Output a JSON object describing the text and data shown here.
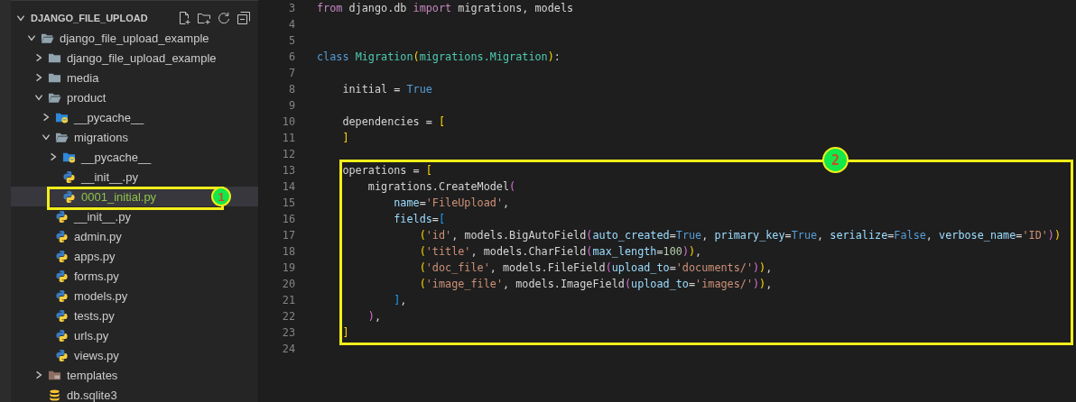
{
  "explorer": {
    "title": "DJANGO_FILE_UPLOAD",
    "expanded": true,
    "tree": [
      {
        "label": "django_file_upload_example",
        "kind": "folder",
        "expanded": true,
        "selected": false,
        "untracked": false,
        "children": [
          {
            "label": "django_file_upload_example",
            "kind": "folder",
            "expanded": false,
            "selected": false,
            "untracked": false
          },
          {
            "label": "media",
            "kind": "folder",
            "expanded": false,
            "selected": false,
            "untracked": false
          },
          {
            "label": "product",
            "kind": "folder",
            "expanded": true,
            "selected": false,
            "untracked": false,
            "children": [
              {
                "label": "__pycache__",
                "kind": "pyfolder",
                "expanded": false,
                "selected": false,
                "untracked": false
              },
              {
                "label": "migrations",
                "kind": "folder",
                "expanded": true,
                "selected": false,
                "untracked": false,
                "children": [
                  {
                    "label": "__pycache__",
                    "kind": "pyfolder",
                    "expanded": false,
                    "selected": false,
                    "untracked": false
                  },
                  {
                    "label": "__init__.py",
                    "kind": "python",
                    "selected": false,
                    "untracked": false
                  },
                  {
                    "label": "0001_initial.py",
                    "kind": "python",
                    "selected": true,
                    "untracked": true,
                    "callout": "1"
                  }
                ]
              },
              {
                "label": "__init__.py",
                "kind": "python",
                "selected": false,
                "untracked": false
              },
              {
                "label": "admin.py",
                "kind": "python",
                "selected": false,
                "untracked": false
              },
              {
                "label": "apps.py",
                "kind": "python",
                "selected": false,
                "untracked": false
              },
              {
                "label": "forms.py",
                "kind": "python",
                "selected": false,
                "untracked": false
              },
              {
                "label": "models.py",
                "kind": "python",
                "selected": false,
                "untracked": false
              },
              {
                "label": "tests.py",
                "kind": "python",
                "selected": false,
                "untracked": false
              },
              {
                "label": "urls.py",
                "kind": "python",
                "selected": false,
                "untracked": false
              },
              {
                "label": "views.py",
                "kind": "python",
                "selected": false,
                "untracked": false
              }
            ]
          },
          {
            "label": "templates",
            "kind": "templates",
            "expanded": false,
            "selected": false,
            "untracked": false
          },
          {
            "label": "db.sqlite3",
            "kind": "database",
            "selected": false,
            "untracked": false
          }
        ]
      }
    ]
  },
  "editor": {
    "lines_before": [
      {
        "number": "3",
        "tokens": [
          {
            "kind": "import",
            "text": "from"
          },
          {
            "kind": "plain",
            "text": " django.db "
          },
          {
            "kind": "import",
            "text": "import"
          },
          {
            "kind": "plain",
            "text": " migrations, models"
          }
        ]
      },
      {
        "number": "4"
      },
      {
        "number": "5"
      },
      {
        "number": "6",
        "tokens": [
          {
            "kind": "keyword",
            "text": "class "
          },
          {
            "kind": "class",
            "text": "Migration"
          },
          {
            "kind": "bracket1",
            "text": "("
          },
          {
            "kind": "class",
            "text": "migrations.Migration"
          },
          {
            "kind": "bracket1",
            "text": ")"
          },
          {
            "kind": "plain",
            "text": ":"
          }
        ]
      },
      {
        "number": "7"
      },
      {
        "number": "8",
        "tokens": [
          {
            "kind": "plain",
            "text": "    initial = "
          },
          {
            "kind": "keyword",
            "text": "True"
          }
        ]
      },
      {
        "number": "9"
      },
      {
        "number": "10",
        "tokens": [
          {
            "kind": "plain",
            "text": "    dependencies = "
          },
          {
            "kind": "bracket1",
            "text": "["
          }
        ]
      },
      {
        "number": "11",
        "tokens": [
          {
            "kind": "bracket1",
            "text": "    ]"
          }
        ]
      },
      {
        "number": "12"
      }
    ],
    "callout": {
      "label": "2",
      "lines": [
        {
          "number": "13",
          "tokens": [
            {
              "kind": "plain",
              "text": "    operations = "
            },
            {
              "kind": "bracket1",
              "text": "["
            }
          ]
        },
        {
          "number": "14",
          "tokens": [
            {
              "kind": "plain",
              "text": "        migrations.CreateModel"
            },
            {
              "kind": "bracket2",
              "text": "("
            }
          ]
        },
        {
          "number": "15",
          "tokens": [
            {
              "kind": "param",
              "text": "            name"
            },
            {
              "kind": "plain",
              "text": "="
            },
            {
              "kind": "string",
              "text": "'FileUpload'"
            },
            {
              "kind": "plain",
              "text": ","
            }
          ]
        },
        {
          "number": "16",
          "tokens": [
            {
              "kind": "param",
              "text": "            fields"
            },
            {
              "kind": "plain",
              "text": "="
            },
            {
              "kind": "bracket3",
              "text": "["
            }
          ]
        },
        {
          "number": "17",
          "tokens": [
            {
              "kind": "bracket1",
              "text": "                ("
            },
            {
              "kind": "string",
              "text": "'id'"
            },
            {
              "kind": "plain",
              "text": ", models.BigAutoField"
            },
            {
              "kind": "bracket2",
              "text": "("
            },
            {
              "kind": "param",
              "text": "auto_created"
            },
            {
              "kind": "plain",
              "text": "="
            },
            {
              "kind": "keyword",
              "text": "True"
            },
            {
              "kind": "plain",
              "text": ", "
            },
            {
              "kind": "param",
              "text": "primary_key"
            },
            {
              "kind": "plain",
              "text": "="
            },
            {
              "kind": "keyword",
              "text": "True"
            },
            {
              "kind": "plain",
              "text": ", "
            },
            {
              "kind": "param",
              "text": "serialize"
            },
            {
              "kind": "plain",
              "text": "="
            },
            {
              "kind": "keyword",
              "text": "False"
            },
            {
              "kind": "plain",
              "text": ", "
            },
            {
              "kind": "param",
              "text": "verbose_name"
            },
            {
              "kind": "plain",
              "text": "="
            },
            {
              "kind": "string",
              "text": "'ID'"
            },
            {
              "kind": "bracket2",
              "text": ")"
            },
            {
              "kind": "bracket1",
              "text": ")"
            }
          ]
        },
        {
          "number": "18",
          "tokens": [
            {
              "kind": "bracket1",
              "text": "                ("
            },
            {
              "kind": "string",
              "text": "'title'"
            },
            {
              "kind": "plain",
              "text": ", models.CharField"
            },
            {
              "kind": "bracket2",
              "text": "("
            },
            {
              "kind": "param",
              "text": "max_length"
            },
            {
              "kind": "plain",
              "text": "="
            },
            {
              "kind": "number",
              "text": "100"
            },
            {
              "kind": "bracket2",
              "text": ")"
            },
            {
              "kind": "bracket1",
              "text": ")"
            },
            {
              "kind": "plain",
              "text": ","
            }
          ]
        },
        {
          "number": "19",
          "tokens": [
            {
              "kind": "bracket1",
              "text": "                ("
            },
            {
              "kind": "string",
              "text": "'doc_file'"
            },
            {
              "kind": "plain",
              "text": ", models.FileField"
            },
            {
              "kind": "bracket2",
              "text": "("
            },
            {
              "kind": "param",
              "text": "upload_to"
            },
            {
              "kind": "plain",
              "text": "="
            },
            {
              "kind": "string",
              "text": "'documents/'"
            },
            {
              "kind": "bracket2",
              "text": ")"
            },
            {
              "kind": "bracket1",
              "text": ")"
            },
            {
              "kind": "plain",
              "text": ","
            }
          ]
        },
        {
          "number": "20",
          "tokens": [
            {
              "kind": "bracket1",
              "text": "                ("
            },
            {
              "kind": "string",
              "text": "'image_file'"
            },
            {
              "kind": "plain",
              "text": ", models.ImageField"
            },
            {
              "kind": "bracket2",
              "text": "("
            },
            {
              "kind": "param",
              "text": "upload_to"
            },
            {
              "kind": "plain",
              "text": "="
            },
            {
              "kind": "string",
              "text": "'images/'"
            },
            {
              "kind": "bracket2",
              "text": ")"
            },
            {
              "kind": "bracket1",
              "text": ")"
            },
            {
              "kind": "plain",
              "text": ","
            }
          ]
        },
        {
          "number": "21",
          "tokens": [
            {
              "kind": "bracket3",
              "text": "            ]"
            },
            {
              "kind": "plain",
              "text": ","
            }
          ]
        },
        {
          "number": "22",
          "tokens": [
            {
              "kind": "bracket2",
              "text": "        )"
            },
            {
              "kind": "plain",
              "text": ","
            }
          ]
        },
        {
          "number": "23",
          "tokens": [
            {
              "kind": "bracket1",
              "text": "    ]"
            }
          ]
        }
      ]
    },
    "lines_after": [
      {
        "number": "24"
      }
    ]
  }
}
